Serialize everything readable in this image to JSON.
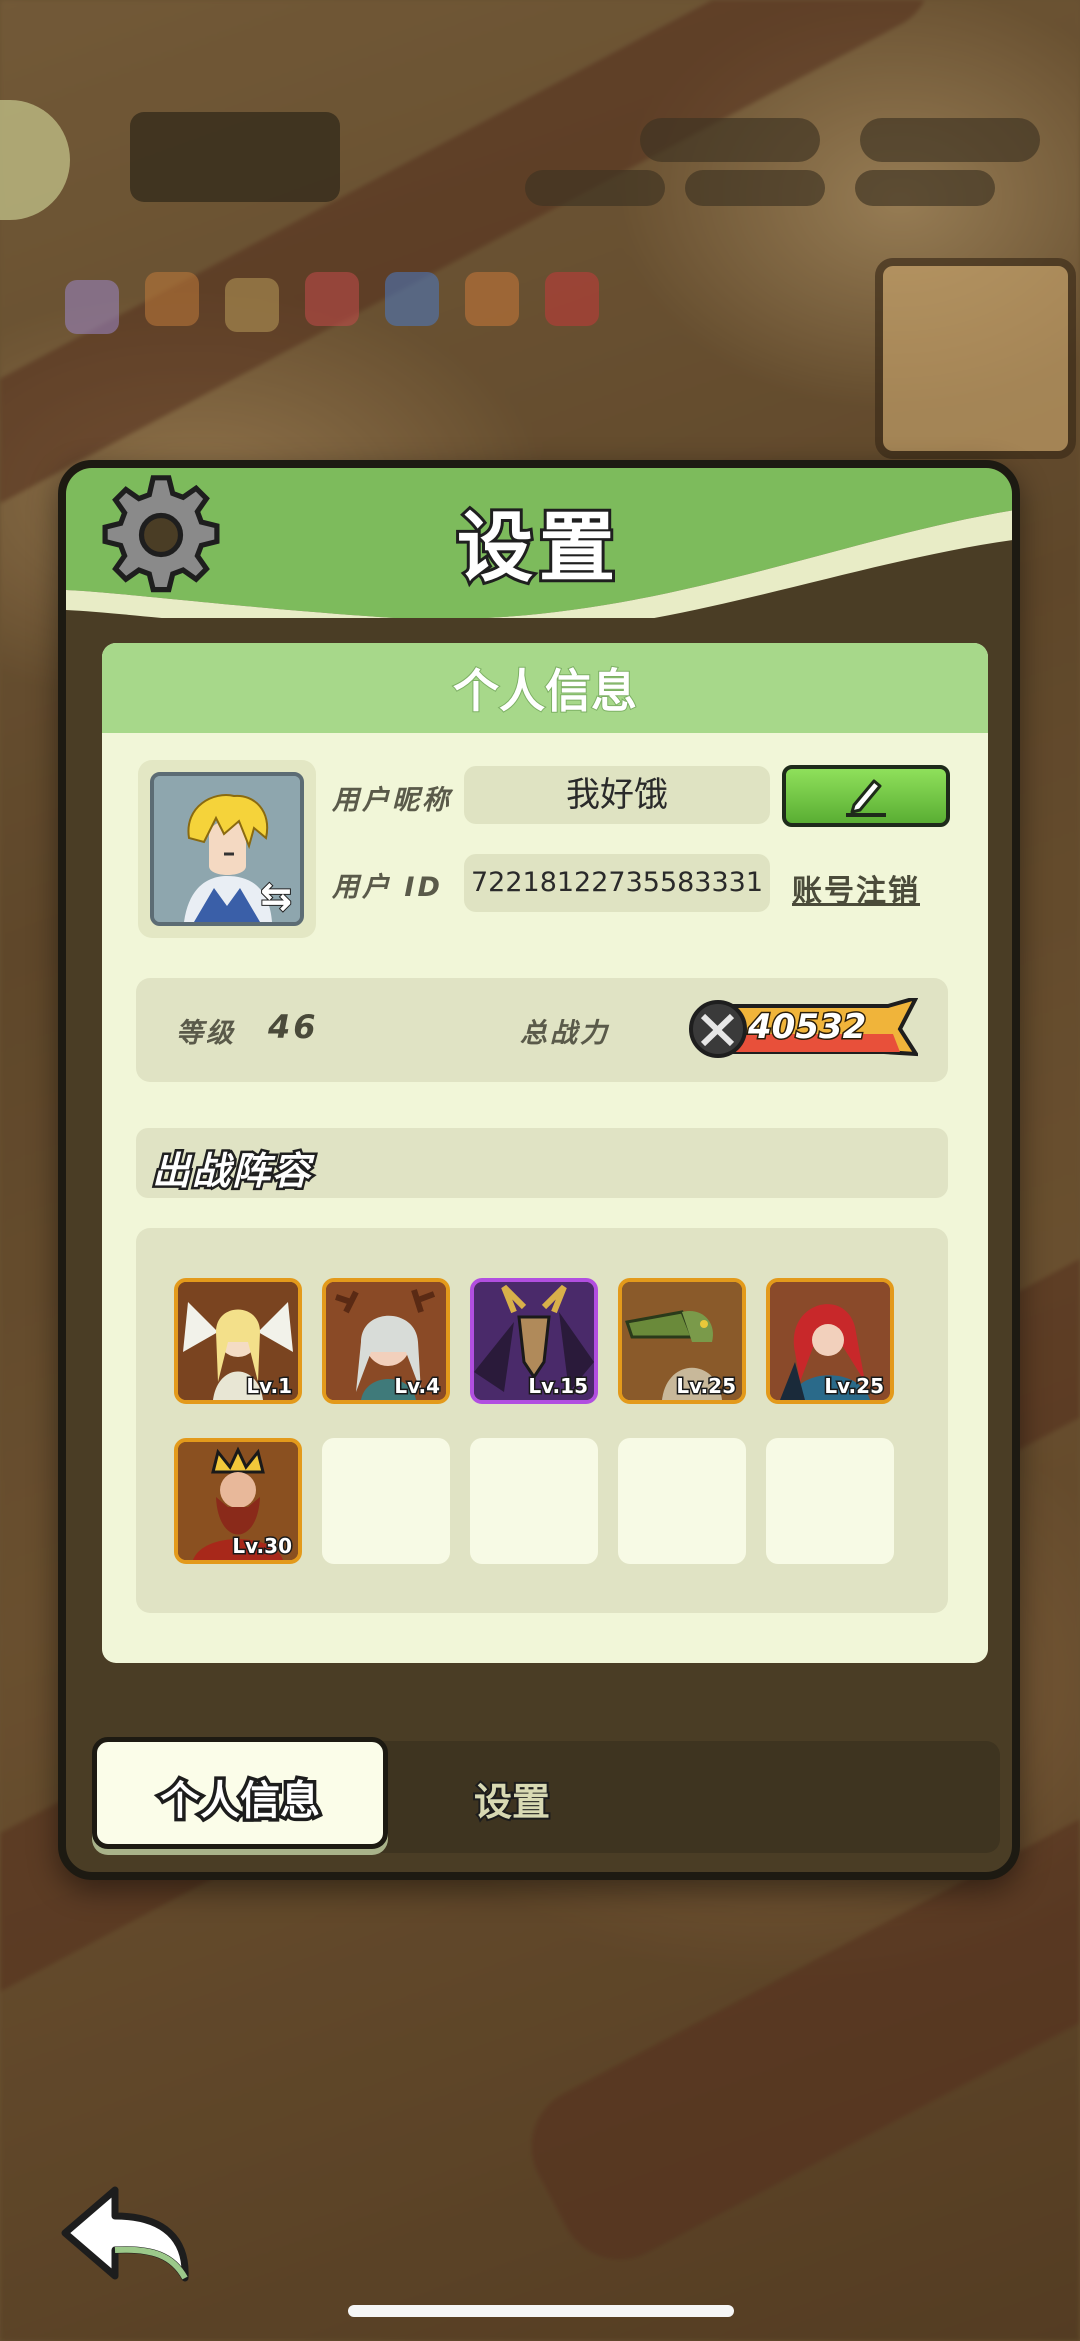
{
  "dialog": {
    "title": "设置"
  },
  "profile": {
    "section_title": "个人信息",
    "nickname_label": "用户昵称",
    "nickname_value": "我好饿",
    "id_label": "用户 ID",
    "id_value": "72218122735583331",
    "cancel_account_label": "账号注销",
    "level_label": "等级",
    "level_value": "46",
    "power_label": "总战力",
    "power_value": "40532"
  },
  "lineup": {
    "title": "出战阵容",
    "heroes": [
      {
        "level": "Lv.1",
        "portrait": "white-haired-angel-portrait",
        "frame_color": "#e39a1b"
      },
      {
        "level": "Lv.4",
        "portrait": "antlered-elf-portrait",
        "frame_color": "#e39a1b"
      },
      {
        "level": "Lv.15",
        "portrait": "horned-demon-portrait",
        "frame_color": "#b14fe0"
      },
      {
        "level": "Lv.25",
        "portrait": "crocodile-warrior-portrait",
        "frame_color": "#e39a1b"
      },
      {
        "level": "Lv.25",
        "portrait": "red-haired-girl-portrait",
        "frame_color": "#e39a1b"
      },
      {
        "level": "Lv.30",
        "portrait": "bearded-king-portrait",
        "frame_color": "#e39a1b"
      }
    ],
    "empty_slots": 4
  },
  "tabs": [
    {
      "label": "个人信息",
      "active": true
    },
    {
      "label": "设置",
      "active": false
    }
  ],
  "colors": {
    "header_green": "#7dbb5c",
    "card_bg": "#f1f6d8",
    "edit_button": "#5aae33",
    "power_bar": "#f0b43a"
  }
}
